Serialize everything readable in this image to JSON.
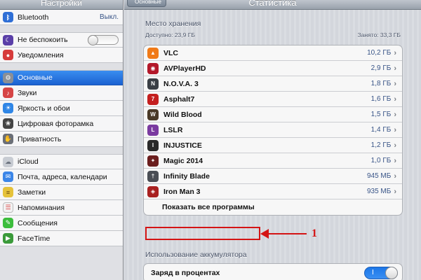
{
  "sidebar": {
    "title": "Настройки",
    "items": [
      {
        "label": "Bluetooth",
        "value": "Выкл.",
        "icon": "bluetooth-icon",
        "color": "#2f6fd6"
      },
      {
        "label": "Не беспокоить",
        "icon": "moon-icon",
        "color": "#5a3fa8",
        "toggle": "off"
      },
      {
        "label": "Уведомления",
        "icon": "notifications-icon",
        "color": "#d63b3b"
      },
      {
        "label": "Основные",
        "icon": "gear-icon",
        "color": "#8a8f97",
        "selected": true
      },
      {
        "label": "Звуки",
        "icon": "speaker-icon",
        "color": "#d64545"
      },
      {
        "label": "Яркость и обои",
        "icon": "brightness-icon",
        "color": "#2f86e6"
      },
      {
        "label": "Цифровая фоторамка",
        "icon": "photo-frame-icon",
        "color": "#444444"
      },
      {
        "label": "Приватность",
        "icon": "hand-icon",
        "color": "#6b6f77"
      },
      {
        "label": "iCloud",
        "icon": "cloud-icon",
        "color": "#c8ccd3"
      },
      {
        "label": "Почта, адреса, календари",
        "icon": "mail-icon",
        "color": "#3c86e8"
      },
      {
        "label": "Заметки",
        "icon": "notes-icon",
        "color": "#e5c23a"
      },
      {
        "label": "Напоминания",
        "icon": "reminders-icon",
        "color": "#f2f2f2"
      },
      {
        "label": "Сообщения",
        "icon": "messages-icon",
        "color": "#3cbd3c"
      },
      {
        "label": "FaceTime",
        "icon": "facetime-icon",
        "color": "#3a9a3a"
      }
    ]
  },
  "header": {
    "back_label": "Основные",
    "title": "Статистика"
  },
  "storage": {
    "section_title": "Место хранения",
    "available": "Доступно: 23,9 ГБ",
    "used": "Занято: 33,3 ГБ",
    "apps": [
      {
        "name": "VLC",
        "size": "10,2 ГБ",
        "icon": "vlc-cone-icon",
        "color": "#f07a18"
      },
      {
        "name": "AVPlayerHD",
        "size": "2,9 ГБ",
        "icon": "avplayer-icon",
        "color": "#b3182a"
      },
      {
        "name": "N.O.V.A. 3",
        "size": "1,8 ГБ",
        "icon": "nova3-icon",
        "color": "#3a3f45"
      },
      {
        "name": "Asphalt7",
        "size": "1,6 ГБ",
        "icon": "asphalt7-icon",
        "color": "#c41f1f"
      },
      {
        "name": "Wild Blood",
        "size": "1,5 ГБ",
        "icon": "wild-blood-icon",
        "color": "#4a3a28"
      },
      {
        "name": "LSLR",
        "size": "1,4 ГБ",
        "icon": "lslr-icon",
        "color": "#7a3aa0"
      },
      {
        "name": "INJUSTICE",
        "size": "1,2 ГБ",
        "icon": "injustice-icon",
        "color": "#2a2a2a"
      },
      {
        "name": "Magic 2014",
        "size": "1,0 ГБ",
        "icon": "magic-2014-icon",
        "color": "#6b1e1e"
      },
      {
        "name": "Infinity Blade",
        "size": "945 МБ",
        "icon": "infinity-blade-icon",
        "color": "#4a4e55"
      },
      {
        "name": "Iron Man 3",
        "size": "935 МБ",
        "icon": "iron-man-3-icon",
        "color": "#a82020"
      }
    ],
    "show_all_label": "Показать все программы"
  },
  "annotation": {
    "number": "1",
    "color": "#d41414"
  },
  "battery": {
    "section_title": "Использование аккумулятора",
    "percent_label": "Заряд в процентах",
    "toggle_label": "I",
    "toggle_on": true
  }
}
